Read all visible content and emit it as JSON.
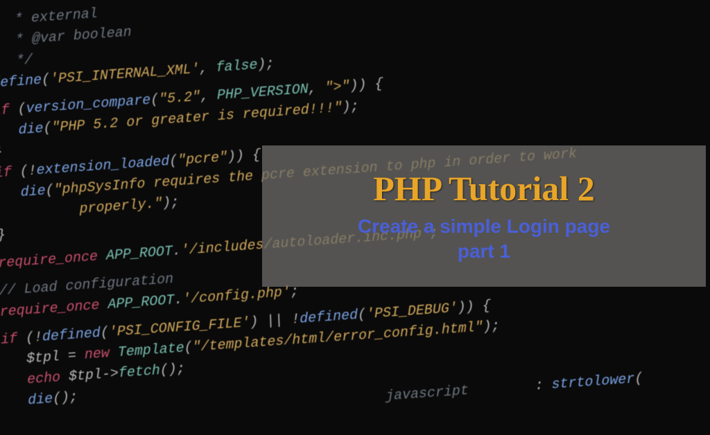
{
  "overlay": {
    "title": "PHP Tutorial 2",
    "subtitle_line1": "Create a simple Login page",
    "subtitle_line2": "part 1"
  },
  "code": {
    "l1": "     * external",
    "l2": "     * @var boolean",
    "l3": "     */",
    "l4_a": "define",
    "l4_b": "'PSI_INTERNAL_XML'",
    "l4_c": "false",
    "l5_a": "if",
    "l5_b": "version_compare",
    "l5_c": "\"5.2\"",
    "l5_d": "PHP_VERSION",
    "l5_e": "\">\"",
    "l6_a": "die",
    "l6_b": "\"PHP 5.2 or greater is required!!!\"",
    "l7": "}",
    "l8_a": "if",
    "l8_b": "extension_loaded",
    "l8_c": "\"pcre\"",
    "l9_a": "die",
    "l9_b": "\"phpSysInfo requires the pcre extension to php in order to work",
    "l10": "            properly.\"",
    "l11": "}",
    "l12_a": "require_once",
    "l12_b": "APP_ROOT",
    "l12_c": "'/includes/autoloader.inc.php'",
    "l13": "// Load configuration",
    "l14_a": "require_once",
    "l14_b": "APP_ROOT",
    "l14_c": "'/config.php'",
    "l15_a": "if",
    "l15_b": "defined",
    "l15_c": "'PSI_CONFIG_FILE'",
    "l15_d": "defined",
    "l15_e": "'PSI_DEBUG'",
    "l16_a": "$tpl",
    "l16_b": "new",
    "l16_c": "Template",
    "l16_d": "\"/templates/html/error_config.html\"",
    "l17_a": "echo",
    "l17_b": "$tpl",
    "l17_c": "fetch",
    "l18_a": "die",
    "l19_a": "javascript",
    "l19_b": "strtolower"
  }
}
